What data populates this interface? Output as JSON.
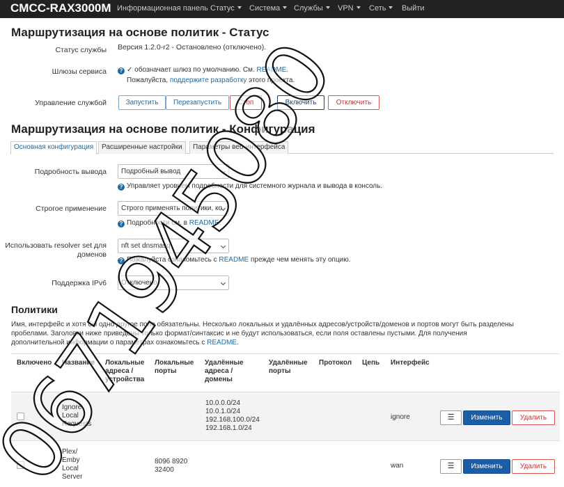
{
  "navbar": {
    "brand": "CMCC-RAX3000M",
    "items": [
      {
        "label": "Информационная панель"
      },
      {
        "label": "Статус"
      },
      {
        "label": "Система"
      },
      {
        "label": "Службы"
      },
      {
        "label": "VPN"
      },
      {
        "label": "Сеть"
      },
      {
        "label": "Выйти"
      }
    ]
  },
  "status": {
    "title": "Маршрутизация на основе политик - Статус",
    "service_status_label": "Статус службы",
    "service_status_value": "Версия 1.2.0-r2 - Остановлено (отключено).",
    "gateways_label": "Шлюзы сервиса",
    "gateways_text1": "✓ обозначает шлюз по умолчанию. См. ",
    "gateways_link1": "README",
    "gateways_text1_end": ".",
    "gateways_text2": "Пожалуйста, ",
    "gateways_link2": "поддержите разработку",
    "gateways_text2_end": " этого проекта.",
    "control_label": "Управление службой",
    "buttons": {
      "start": "Запустить",
      "restart": "Перезапустить",
      "stop": "Стоп",
      "enable": "Включить",
      "disable": "Отключить"
    }
  },
  "config": {
    "title": "Маршрутизация на основе политик - Конфигурация",
    "tabs": [
      {
        "label": "Основная конфигурация"
      },
      {
        "label": "Расширенные настройки"
      },
      {
        "label": "Параметры веб-интерфейса"
      }
    ],
    "verbosity_label": "Подробность вывода",
    "verbosity_value": "Подробный вывод",
    "verbosity_help": "Управляет уровнем подробности для системного журнала и вывода в консоль.",
    "strict_label": "Строгое применение",
    "strict_value": "Строго применять политики, ко",
    "strict_help_text": "Подробности см. в ",
    "strict_help_link": "README",
    "strict_help_end": ".",
    "resolver_label": "Использовать resolver set для доменов",
    "resolver_value": "nft set dnsmasq",
    "resolver_help_text": "Пожалуйста ознакомьтесь с ",
    "resolver_help_link": "README",
    "resolver_help_end": " прежде чем менять эту опцию.",
    "ipv6_label": "Поддержка IPv6",
    "ipv6_value": "Отключено"
  },
  "policies": {
    "title": "Политики",
    "description1": "Имя, интерфейс и хотя бы одно другое поле обязательны. Несколько локальных и удалённых адресов/устройств/доменов и портов могут быть разделены",
    "description2": "пробелами. Заголовки ниже приведены только формат/синтаксис и не будут использоваться, если поля оставлены пустыми. Для получения",
    "description3_text": "дополнительной информации о параметрах ознакомьтесь с ",
    "description3_link": "README",
    "description3_end": ".",
    "columns": {
      "enabled": "Включено",
      "name": "Название",
      "local_addr": "Локальные адреса / устройства",
      "local_ports": "Локальные порты",
      "remote_addr": "Удалённые адреса / домены",
      "remote_ports": "Удалённые порты",
      "protocol": "Протокол",
      "chain": "Цепь",
      "interface": "Интерфейс"
    },
    "rows": [
      {
        "name": "Ignore Local Requests",
        "local_ports": "",
        "remote_addr": [
          "10.0.0.0/24",
          "10.0.1.0/24",
          "192.168.100.0/24",
          "192.168.1.0/24"
        ],
        "interface": "ignore",
        "edit": "Изменить",
        "delete": "Удалить"
      },
      {
        "name": "Plex/ Emby Local Server",
        "local_ports": "8096 8920 32400",
        "remote_addr": [],
        "interface": "wan",
        "edit": "Изменить",
        "delete": "Удалить"
      }
    ]
  },
  "watermark": "0671945080",
  "colors": {
    "navbar": "#222222",
    "link": "#1c6ba6",
    "primary": "#1c5ea6",
    "danger": "#c9302c"
  }
}
